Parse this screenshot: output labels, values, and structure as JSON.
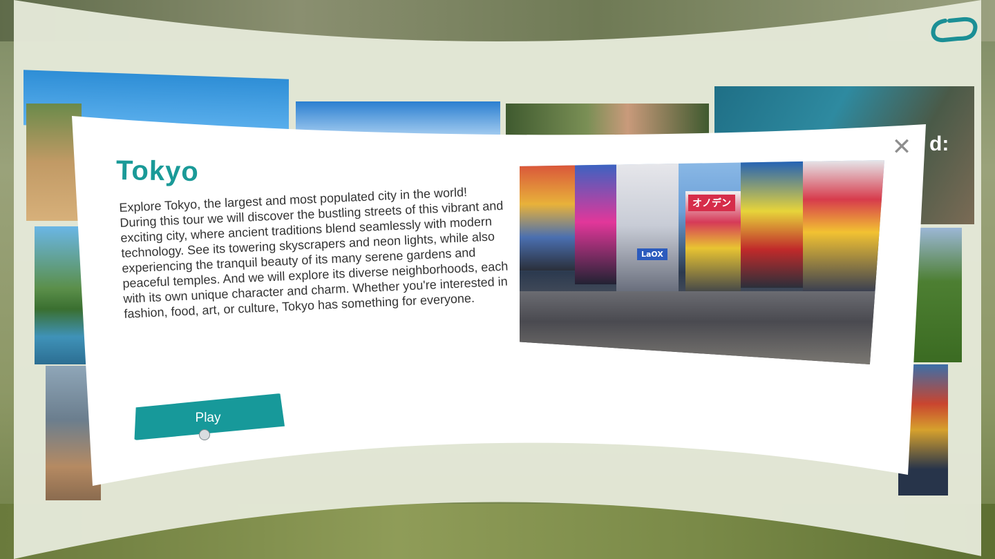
{
  "dialog": {
    "title": "Tokyo",
    "description": "Explore Tokyo, the largest and most populated city in the world! During this tour we will discover the bustling streets of this vibrant and exciting city, where ancient traditions blend seamlessly with modern technology. See its towering skyscrapers and neon lights, while also experiencing the tranquil beauty of its many serene gardens and peaceful temples. And we will explore its diverse neighborhoods, each with its own unique character and charm. Whether you're interested in fashion, food, art, or culture, Tokyo has something for everyone.",
    "play_label": "Play",
    "close_icon": "close-icon",
    "image_signs": [
      "オノデン",
      "LaOX"
    ]
  },
  "background": {
    "peek_text": "d:"
  },
  "colors": {
    "accent": "#17999a",
    "title": "#1a9a98",
    "panel": "#e4e8d8"
  }
}
